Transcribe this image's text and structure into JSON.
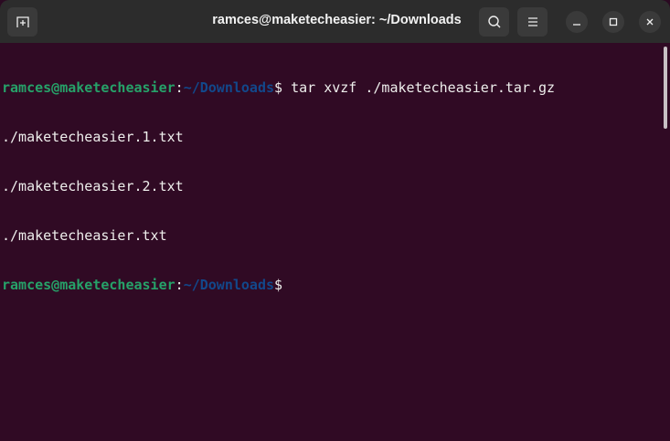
{
  "window": {
    "title": "ramces@maketecheasier: ~/Downloads"
  },
  "header": {
    "new_tab_icon": "new-tab-icon",
    "search_icon": "search-icon",
    "menu_icon": "hamburger-menu-icon",
    "minimize_icon": "minimize-icon",
    "maximize_icon": "maximize-icon",
    "close_icon": "close-icon"
  },
  "terminal": {
    "prompt1": {
      "user": "ramces@maketecheasier",
      "sep": ":",
      "path": "~/Downloads",
      "symbol": "$",
      "command": " tar xvzf ./maketecheasier.tar.gz"
    },
    "output": [
      "./maketecheasier.1.txt",
      "./maketecheasier.2.txt",
      "./maketecheasier.txt"
    ],
    "prompt2": {
      "user": "ramces@maketecheasier",
      "sep": ":",
      "path": "~/Downloads",
      "symbol": "$"
    }
  },
  "colors": {
    "background": "#300a24",
    "user": "#26a269",
    "path": "#12488b",
    "header": "#2c2c2c"
  }
}
